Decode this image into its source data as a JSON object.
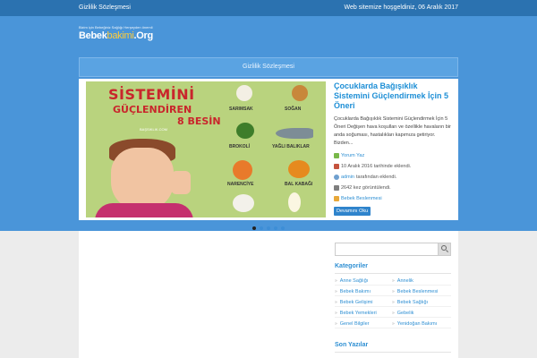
{
  "topbar": {
    "left_link": "Gizlilik Sözleşmesi",
    "welcome": "Web sitemize hoşgeldiniz, 06 Aralık 2017"
  },
  "logo": {
    "tagline": "Bizim için Bebeğiniz Sağlığı Herşeyden önemli",
    "brand_main": "Bebek",
    "brand_highlight": "bakimi",
    "brand_tld": ".Org"
  },
  "nav": {
    "item": "Gizlilik Sözleşmesi"
  },
  "slide": {
    "image_title_line1": "SİSTEMİNİ",
    "image_title_line2": "GÜÇLENDİREN",
    "image_title_line3": "8 BESİN",
    "image_site": "BAŞSIKLIK.COM",
    "food_labels": [
      "SARIMSAK",
      "SOĞAN",
      "BROKOLİ",
      "YAĞLI BALIKLAR",
      "NARENCİYE",
      "BAL KABAĞI"
    ],
    "title": "Çocuklarda Bağışıklık Sistemini Güçlendirmek İçin 5 Öneri",
    "excerpt": "Çocuklarda Bağışıklık Sistemini Güçlendirmek İçin 5 Öneri Değişen hava koşulları ve özellikle havaların bir anda soğuması, hastalıkları kapımıza getiriyor. Bizden...",
    "comment_link": "Yorum Yaz",
    "date_added": "10 Aralık 2016 tarihinde eklendi.",
    "author": "admin",
    "author_suffix": "tarafından eklendi.",
    "views": "2642 kez görüntülendi.",
    "category": "Bebek Beslenmesi",
    "read_more": "Devamını Oku"
  },
  "slider_dots": {
    "count": 5,
    "active_index": 0
  },
  "sidebar": {
    "search_placeholder": "",
    "categories_title": "Kategoriler",
    "categories": [
      "Anne Sağlığı",
      "Annelik",
      "Bebek Bakımı",
      "Bebek Beslenmesi",
      "Bebek Gelişimi",
      "Bebek Sağlığı",
      "Bebek Yemekleri",
      "Gebelik",
      "Genel Bilgiler",
      "Yenidoğan Bakımı"
    ],
    "recent_title": "Son Yazılar"
  },
  "colors": {
    "topbar": "#2b72b0",
    "hero": "#4a95d9",
    "accent": "#2e8fd3",
    "logo_highlight": "#ffcc3a"
  }
}
